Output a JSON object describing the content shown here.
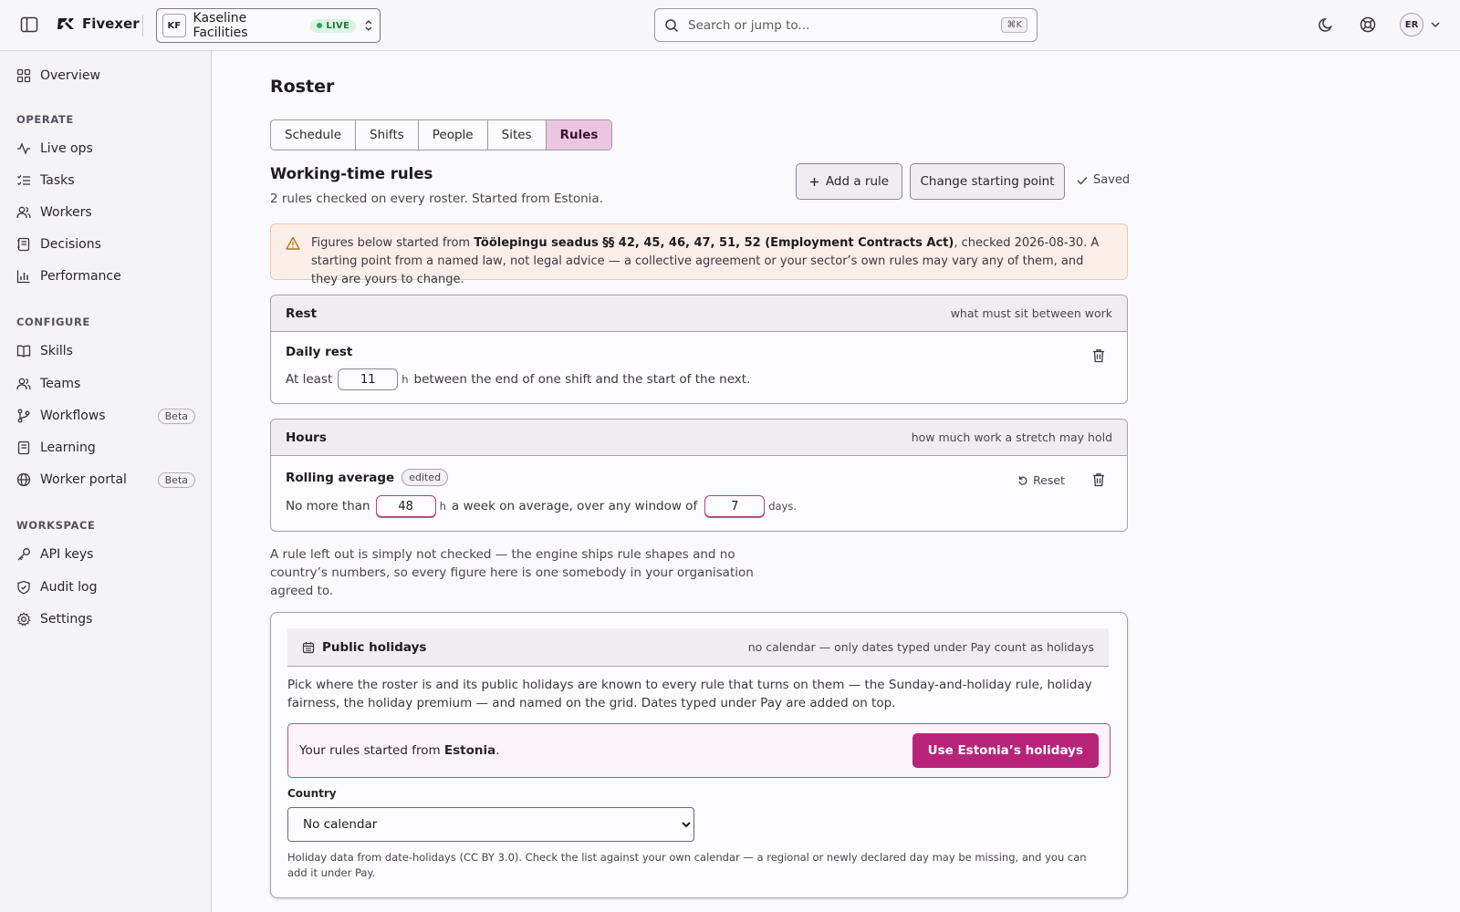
{
  "app": {
    "brand": "Fivexer",
    "workspace": {
      "initials": "KF",
      "name": "Kaseline Facilities",
      "status": "LIVE"
    },
    "search": {
      "placeholder": "Search or jump to...",
      "shortcut": "⌘K"
    },
    "user": {
      "initials": "ER"
    }
  },
  "sidebar": {
    "overview": "Overview",
    "sections": {
      "operate": "OPERATE",
      "configure": "CONFIGURE",
      "workspace": "WORKSPACE"
    },
    "operate_items": [
      "Live ops",
      "Tasks",
      "Workers",
      "Decisions",
      "Performance"
    ],
    "configure_items": [
      "Skills",
      "Teams",
      "Workflows",
      "Learning",
      "Worker portal"
    ],
    "workspace_items": [
      "API keys",
      "Audit log",
      "Settings"
    ],
    "beta_label": "Beta"
  },
  "page": {
    "title": "Roster",
    "tabs": [
      "Schedule",
      "Shifts",
      "People",
      "Sites",
      "Rules"
    ],
    "active_tab": "Rules"
  },
  "rules": {
    "title": "Working-time rules",
    "subtitle": "2 rules checked on every roster. Started from Estonia.",
    "add_rule_label": "Add a rule",
    "change_start_label": "Change starting point",
    "saved_label": "Saved",
    "notice": {
      "prefix": "Figures below started from ",
      "law": "Töölepingu seadus §§ 42, 45, 46, 47, 51, 52 (Employment Contracts Act)",
      "suffix": ", checked 2026-08-30. A starting point from a named law, not legal advice — a collective agreement or your sector’s own rules may vary any of them, and they are yours to change."
    },
    "rest_group": {
      "title": "Rest",
      "hint": "what must sit between work",
      "rule_name": "Daily rest",
      "prefix": "At least",
      "value": "11",
      "unit": "h",
      "suffix": "between the end of one shift and the start of the next."
    },
    "hours_group": {
      "title": "Hours",
      "hint": "how much work a stretch may hold",
      "rule_name": "Rolling average",
      "edited_label": "edited",
      "reset_label": "Reset",
      "prefix": "No more than",
      "hours_value": "48",
      "hours_unit": "h",
      "middle": "a week on average, over any window of",
      "days_value": "7",
      "days_unit": "days."
    },
    "footnote": "A rule left out is simply not checked — the engine ships rule shapes and no country’s numbers, so every figure here is one somebody in your organisation agreed to."
  },
  "holidays": {
    "title": "Public holidays",
    "hint": "no calendar — only dates typed under Pay count as holidays",
    "description": "Pick where the roster is and its public holidays are known to every rule that turns on them — the Sunday-and-holiday rule, holiday fairness, the holiday premium — and named on the grid. Dates typed under Pay are added on top.",
    "start_prefix": "Your rules started from ",
    "start_country": "Estonia",
    "start_suffix": ".",
    "use_button": "Use Estonia’s holidays",
    "country_label": "Country",
    "country_value": "No calendar",
    "footer": "Holiday data from date-holidays (CC BY 3.0). Check the list against your own calendar — a regional or newly declared day may be missing, and you can add it under Pay."
  },
  "colors": {
    "accent": "#b8237a",
    "active_tab_bg": "#ecc6e0",
    "live_green": "#28a55a",
    "notice_bg": "#fbeee8"
  }
}
